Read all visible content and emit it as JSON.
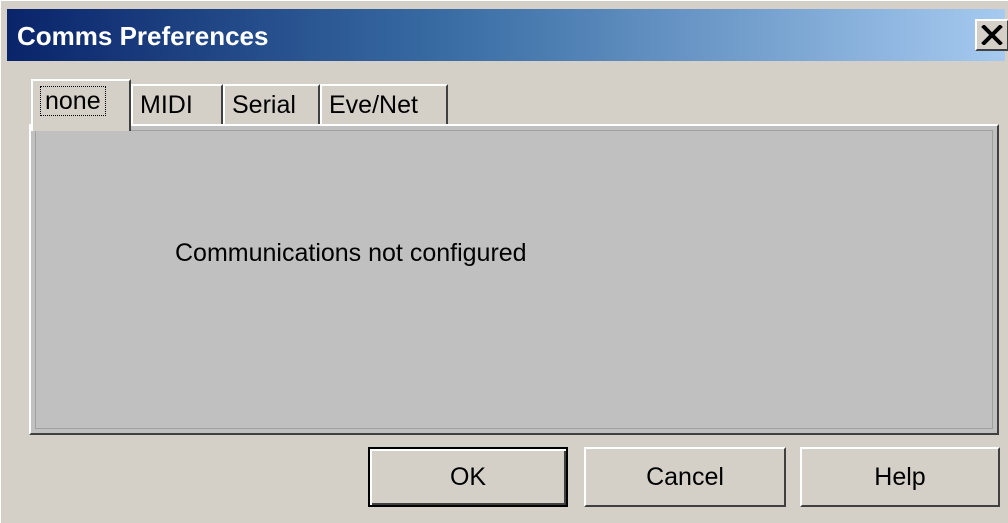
{
  "window": {
    "title": "Comms Preferences",
    "close_label": "X"
  },
  "tabs": [
    {
      "label": "none",
      "selected": true
    },
    {
      "label": "MIDI",
      "selected": false
    },
    {
      "label": "Serial",
      "selected": false
    },
    {
      "label": "Eve/Net",
      "selected": false
    }
  ],
  "panel": {
    "message": "Communications not configured"
  },
  "buttons": {
    "ok": "OK",
    "cancel": "Cancel",
    "help": "Help"
  },
  "colors": {
    "face": "#d4d0c8",
    "panel": "#c0c0c0",
    "title_start": "#0a246a",
    "title_end": "#a6caf0"
  }
}
